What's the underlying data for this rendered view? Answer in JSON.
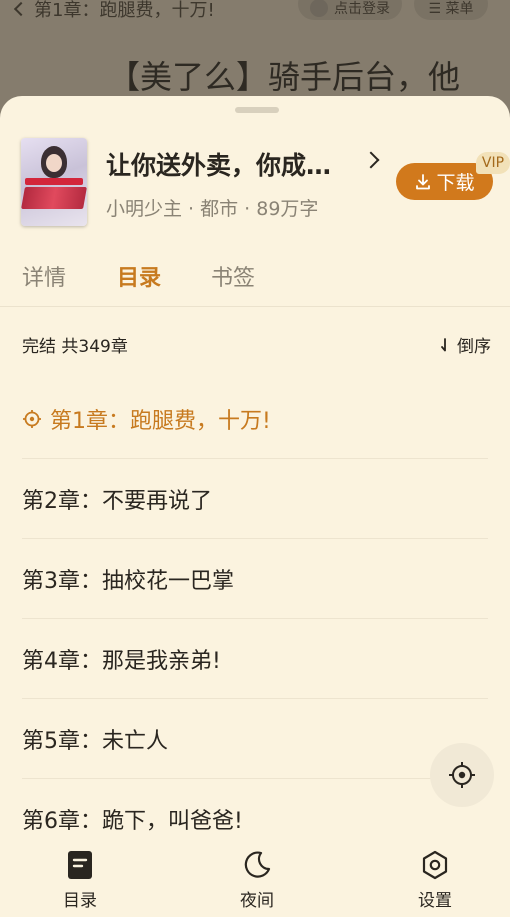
{
  "background": {
    "back_label": "第1章：跑腿费，十万!",
    "login_label": "点击登录",
    "menu_label": "☰ 菜单",
    "chapter_heading": "【美了么】骑手后台，他"
  },
  "book": {
    "title": "让你送外卖，你成…",
    "meta": "小明少主 · 都市 · 89万字",
    "download_label": "下载",
    "vip_label": "VIP"
  },
  "tabs": [
    {
      "label": "详情"
    },
    {
      "label": "目录"
    },
    {
      "label": "书签"
    }
  ],
  "toc": {
    "status": "完结 共349章",
    "sort_label": "倒序",
    "chapters": [
      {
        "label": "第1章：跑腿费，十万!"
      },
      {
        "label": "第2章：不要再说了"
      },
      {
        "label": "第3章：抽校花一巴掌"
      },
      {
        "label": "第4章：那是我亲弟!"
      },
      {
        "label": "第5章：未亡人"
      },
      {
        "label": "第6章：跪下，叫爸爸!"
      }
    ]
  },
  "bottom_nav": [
    {
      "label": "目录",
      "icon": "book-icon"
    },
    {
      "label": "夜间",
      "icon": "moon-icon"
    },
    {
      "label": "设置",
      "icon": "gear-icon"
    }
  ],
  "colors": {
    "accent": "#c77a1f",
    "download_bg": "#d1791c",
    "sheet_bg": "#fbf3df"
  }
}
